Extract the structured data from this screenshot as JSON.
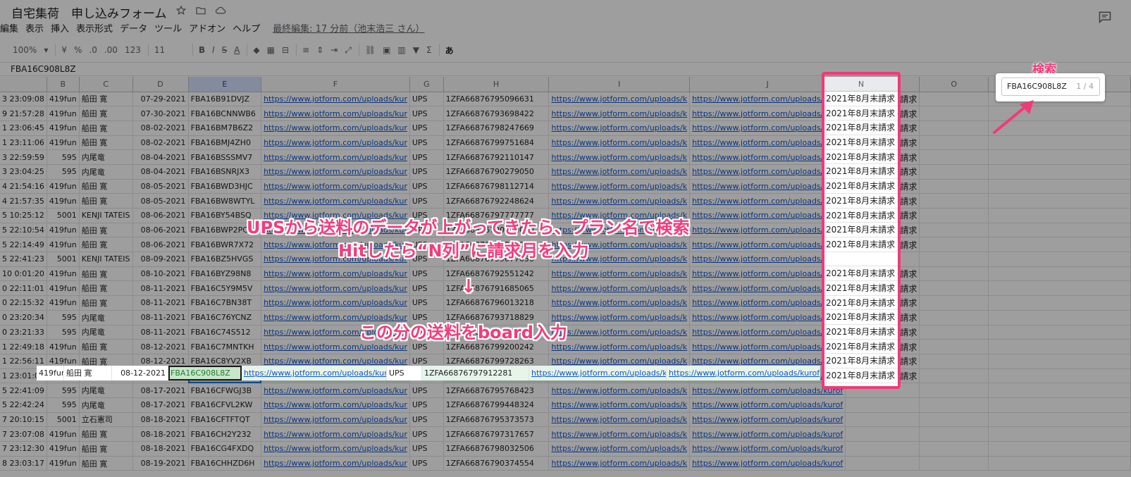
{
  "doc": {
    "title": "自宅集荷　申し込みフォーム",
    "last_edit": "最終編集: 17 分前（池末浩三 さん）"
  },
  "menu": [
    "編集",
    "表示",
    "挿入",
    "表示形式",
    "データ",
    "ツール",
    "アドオン",
    "ヘルプ"
  ],
  "toolbar": {
    "zoom": "100%",
    "currency": "¥",
    "percent": "%",
    "dec_less": ".0",
    "dec_more": ".00",
    "format": "123",
    "font_size": "11",
    "bold": "B",
    "italic": "I",
    "strike": "S",
    "text_color": "A",
    "input_tool": "あ"
  },
  "formula_bar": {
    "value": "FBA16C908L8Z"
  },
  "columns": [
    "B",
    "C",
    "D",
    "E",
    "F",
    "G",
    "H",
    "I",
    "J",
    "N",
    "O"
  ],
  "rows": [
    {
      "a": "3 23:09:08",
      "b": "419fun",
      "c": "船田 寛",
      "d": "07-29-2021",
      "e": "FBA16B91DVJZ",
      "f": "https://www.jotform.com/uploads/kur",
      "g": "UPS",
      "h": "1ZFA66876795096631",
      "i": "https://www.jotform.com/uploads/k",
      "j": "https://www.jotform.com/uploads/kurof",
      "n": "2021年8月末請求"
    },
    {
      "a": "9 21:57:28",
      "b": "419fun",
      "c": "船田 寛",
      "d": "07-30-2021",
      "e": "FBA16BCNNWB6",
      "f": "https://www.jotform.com/uploads/kur",
      "g": "UPS",
      "h": "1ZFA66876793698422",
      "i": "https://www.jotform.com/uploads/k",
      "j": "https://www.jotform.com/uploads/kurof",
      "n": "2021年8月末請求"
    },
    {
      "a": "1 23:06:45",
      "b": "419fun",
      "c": "船田 寛",
      "d": "08-02-2021",
      "e": "FBA16BM7B6Z2",
      "f": "https://www.jotform.com/uploads/kur",
      "g": "UPS",
      "h": "1ZFA66876798247669",
      "i": "https://www.jotform.com/uploads/k",
      "j": "https://www.jotform.com/uploads/kurof",
      "n": "2021年8月末請求"
    },
    {
      "a": "1 23:11:06",
      "b": "419fun",
      "c": "船田 寛",
      "d": "08-02-2021",
      "e": "FBA16BMJ4ZH0",
      "f": "https://www.jotform.com/uploads/kur",
      "g": "UPS",
      "h": "1ZFA66876799751684",
      "i": "https://www.jotform.com/uploads/k",
      "j": "https://www.jotform.com/uploads/kurof",
      "n": "2021年8月末請求"
    },
    {
      "a": "3 22:59:59",
      "b": "595",
      "c": "内尾竜",
      "d": "08-04-2021",
      "e": "FBA16BSSSMV7",
      "f": "https://www.jotform.com/uploads/kur",
      "g": "UPS",
      "h": "1ZFA66876792110147",
      "i": "https://www.jotform.com/uploads/k",
      "j": "https://www.jotform.com/uploads/kurof",
      "n": "2021年8月末請求"
    },
    {
      "a": "3 23:04:25",
      "b": "595",
      "c": "内尾竜",
      "d": "08-04-2021",
      "e": "FBA16BSNRJX3",
      "f": "https://www.jotform.com/uploads/kur",
      "g": "UPS",
      "h": "1ZFA66876790279050",
      "i": "https://www.jotform.com/uploads/k",
      "j": "https://www.jotform.com/uploads/kurof",
      "n": "2021年8月末請求"
    },
    {
      "a": "4 21:54:16",
      "b": "419fun",
      "c": "船田 寛",
      "d": "08-05-2021",
      "e": "FBA16BWD3HJC",
      "f": "https://www.jotform.com/uploads/kur",
      "g": "UPS",
      "h": "1ZFA66876798112714",
      "i": "https://www.jotform.com/uploads/k",
      "j": "https://www.jotform.com/uploads/kurof",
      "n": "2021年8月末請求"
    },
    {
      "a": "4 21:57:35",
      "b": "419fun",
      "c": "船田 寛",
      "d": "08-05-2021",
      "e": "FBA16BW8WTYL",
      "f": "https://www.jotform.com/uploads/kur",
      "g": "UPS",
      "h": "1ZFA66876792248624",
      "i": "https://www.jotform.com/uploads/k",
      "j": "https://www.jotform.com/uploads/kurof",
      "n": "2021年8月末請求"
    },
    {
      "a": "5 10:25:12",
      "b": "5001",
      "c": "KENJI TATEIS",
      "d": "08-06-2021",
      "e": "FBA16BY54BSQ",
      "f": "https://www.jotform.com/uploads/kur",
      "g": "UPS",
      "h": "1ZFA66876797777777",
      "i": "https://www.jotform.com/uploads/k",
      "j": "https://www.jotform.com/uploads/kurof",
      "n": "2021年8月末請求"
    },
    {
      "a": "5 22:10:54",
      "b": "419fun",
      "c": "船田 寛",
      "d": "08-06-2021",
      "e": "FBA16BWP2PCQ",
      "f": "https://www.jotform.com/uploads/kur",
      "g": "UPS",
      "h": "1ZFA66876790000000",
      "i": "https://www.jotform.com/uploads/k",
      "j": "https://www.jotform.com/uploads/kurof",
      "n": "2021年8月末請求"
    },
    {
      "a": "5 22:14:49",
      "b": "419fun",
      "c": "船田 寛",
      "d": "08-06-2021",
      "e": "FBA16BWR7X72",
      "f": "https://www.jotform.com/uploads/kur",
      "g": "UPS",
      "h": "1ZFA66876790000001",
      "i": "https://www.jotform.com/uploads/k",
      "j": "https://www.jotform.com/uploads/kurof",
      "n": "2021年8月末請求"
    },
    {
      "a": "5 22:41:23",
      "b": "5001",
      "c": "KENJI TATEIS",
      "d": "08-09-2021",
      "e": "FBA16BZ5HVGS",
      "f": "https://www.jotform.com/uploads/kur",
      "g": "UPS",
      "h": "1ZFA66876799077056",
      "i": "https://www.jotform.com/uploads/k",
      "j": "https://www.jotform.com/uploads/kurof",
      "n": ""
    },
    {
      "a": "10 0:01:20",
      "b": "419fun",
      "c": "船田 寛",
      "d": "08-10-2021",
      "e": "FBA16BYZ98N8",
      "f": "https://www.jotform.com/uploads/kur",
      "g": "UPS",
      "h": "1ZFA66876792551242",
      "i": "https://www.jotform.com/uploads/k",
      "j": "https://www.jotform.com/uploads/kurof",
      "n": "2021年8月末請求"
    },
    {
      "a": "0 22:11:01",
      "b": "419fun",
      "c": "船田 寛",
      "d": "08-11-2021",
      "e": "FBA16C5Y9M5V",
      "f": "https://www.jotform.com/uploads/kur",
      "g": "UPS",
      "h": "1ZFA66876791685065",
      "i": "https://www.jotform.com/uploads/k",
      "j": "https://www.jotform.com/uploads/kurof",
      "n": "2021年8月末請求"
    },
    {
      "a": "0 22:15:32",
      "b": "419fun",
      "c": "船田 寛",
      "d": "08-11-2021",
      "e": "FBA16C7BN38T",
      "f": "https://www.jotform.com/uploads/kur",
      "g": "UPS",
      "h": "1ZFA66876796013218",
      "i": "https://www.jotform.com/uploads/k",
      "j": "https://www.jotform.com/uploads/kurof",
      "n": "2021年8月末請求"
    },
    {
      "a": "0 23:20:34",
      "b": "595",
      "c": "内尾竜",
      "d": "08-11-2021",
      "e": "FBA16C76YCNZ",
      "f": "https://www.jotform.com/uploads/kur",
      "g": "UPS",
      "h": "1ZFA66876793718829",
      "i": "https://www.jotform.com/uploads/k",
      "j": "https://www.jotform.com/uploads/kurof",
      "n": "2021年8月末請求"
    },
    {
      "a": "0 23:21:33",
      "b": "595",
      "c": "内尾竜",
      "d": "08-11-2021",
      "e": "FBA16C74S512",
      "f": "https://www.jotform.com/uploads/kur",
      "g": "UPS",
      "h": "1ZFA66876790000002",
      "i": "https://www.jotform.com/uploads/k",
      "j": "https://www.jotform.com/uploads/kurof",
      "n": "2021年8月末請求"
    },
    {
      "a": "1 22:49:18",
      "b": "419fun",
      "c": "船田 寛",
      "d": "08-12-2021",
      "e": "FBA16C7MNTKH",
      "f": "https://www.jotform.com/uploads/kur",
      "g": "UPS",
      "h": "1ZFA66876799200242",
      "i": "https://www.jotform.com/uploads/k",
      "j": "https://www.jotform.com/uploads/kurof",
      "n": "2021年8月末請求"
    },
    {
      "a": "1 22:56:11",
      "b": "419fun",
      "c": "船田 寛",
      "d": "08-12-2021",
      "e": "FBA16C8YV2XB",
      "f": "https://www.jotform.com/uploads/kur",
      "g": "UPS",
      "h": "1ZFA66876799728263",
      "i": "https://www.jotform.com/uploads/k",
      "j": "https://www.jotform.com/uploads/kurof",
      "n": "2021年8月末請求"
    },
    {
      "a": "1 23:01:09",
      "b": "419fun",
      "c": "船田 寛",
      "d": "08-12-2021",
      "e": "FBA16C908L8Z",
      "f": "https://www.jotform.com/uploads/kur",
      "g": "UPS",
      "h": "1ZFA66876797912281",
      "i": "https://www.jotform.com/uploads/k",
      "j": "https://www.jotform.com/uploads/kurof",
      "n": "2021年8月末請求",
      "active": true
    },
    {
      "a": "5 22:41:09",
      "b": "595",
      "c": "内尾竜",
      "d": "08-17-2021",
      "e": "FBA16CFWGJ3B",
      "f": "https://www.jotform.com/uploads/kur",
      "g": "UPS",
      "h": "1ZFA66876795768423",
      "i": "https://www.jotform.com/uploads/k",
      "j": "https://www.jotform.com/uploads/kurof",
      "n": ""
    },
    {
      "a": "5 22:42:24",
      "b": "595",
      "c": "内尾竜",
      "d": "08-17-2021",
      "e": "FBA16CFVL2KW",
      "f": "https://www.jotform.com/uploads/kur",
      "g": "UPS",
      "h": "1ZFA66876799448324",
      "i": "https://www.jotform.com/uploads/k",
      "j": "https://www.jotform.com/uploads/kurof",
      "n": ""
    },
    {
      "a": "7 20:10:15",
      "b": "5001",
      "c": "立石憲司",
      "d": "08-18-2021",
      "e": "FBA16CFTFTQT",
      "f": "https://www.jotform.com/uploads/kur",
      "g": "UPS",
      "h": "1ZFA66876795373573",
      "i": "https://www.jotform.com/uploads/k",
      "j": "https://www.jotform.com/uploads/kurof",
      "n": ""
    },
    {
      "a": "7 23:07:08",
      "b": "419fun",
      "c": "船田 寛",
      "d": "08-18-2021",
      "e": "FBA16CH2Y232",
      "f": "https://www.jotform.com/uploads/kur",
      "g": "UPS",
      "h": "1ZFA66876797317657",
      "i": "https://www.jotform.com/uploads/k",
      "j": "https://www.jotform.com/uploads/kurof",
      "n": ""
    },
    {
      "a": "7 23:12:30",
      "b": "419fun",
      "c": "船田 寛",
      "d": "08-18-2021",
      "e": "FBA16CG4FXDQ",
      "f": "https://www.jotform.com/uploads/kur",
      "g": "UPS",
      "h": "1ZFA66876798032506",
      "i": "https://www.jotform.com/uploads/k",
      "j": "https://www.jotform.com/uploads/kurof",
      "n": ""
    },
    {
      "a": "8 23:03:17",
      "b": "419fun",
      "c": "船田 寛",
      "d": "08-19-2021",
      "e": "FBA16CHHZD6H",
      "f": "https://www.jotform.com/uploads/kur",
      "g": "UPS",
      "h": "1ZFA66876790374554",
      "i": "https://www.jotform.com/uploads/k",
      "j": "https://www.jotform.com/uploads/kurof",
      "n": ""
    }
  ],
  "search": {
    "label": "検索",
    "query": "FBA16C908L8Z",
    "count": "1 / 4"
  },
  "annotations": {
    "line1": "UPSから送料のデータが上がってきたら、プラン名で検索",
    "line2": "Hitしたら“N列”に請求月を入力",
    "arrow": "↓",
    "line3": "この分の送料をboard入力"
  }
}
